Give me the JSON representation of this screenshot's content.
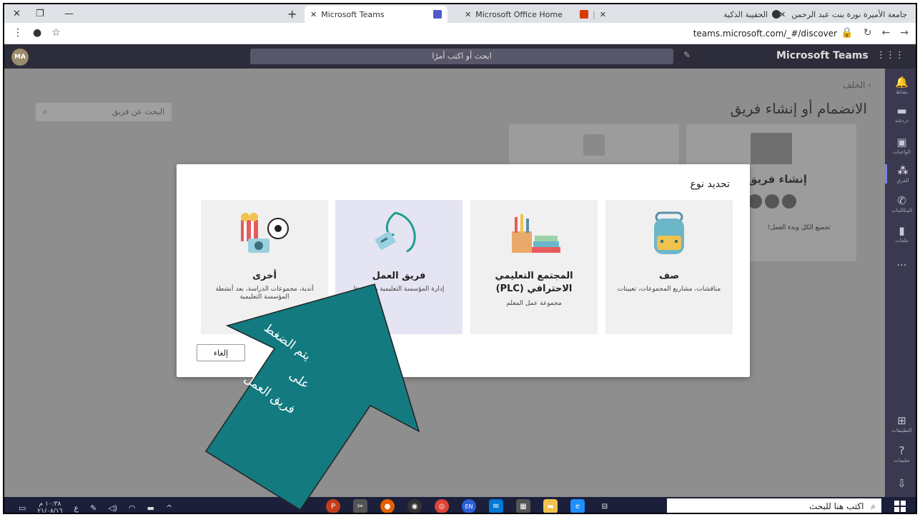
{
  "browser": {
    "tabs": [
      {
        "title": "Microsoft Teams",
        "active": true
      },
      {
        "title": "Microsoft Office Home",
        "active": false
      },
      {
        "title": "جامعة الأميرة نورة بنت عبد الرحمن",
        "active": false
      },
      {
        "title": "الحقيبة الذكية",
        "active": false
      }
    ],
    "new_tab_label": "+",
    "url": "teams.microsoft.com/_#/discover"
  },
  "teams": {
    "app_title": "Microsoft Teams",
    "avatar_initials": "MA",
    "search_placeholder": "ابحث أو اكتب أمرًا",
    "back_label": "الخلف",
    "page_title": "الانضمام أو إنشاء فريق",
    "team_search_placeholder": "البحث عن فريق",
    "bg_card_title": "إنشاء فريق",
    "bg_card_sub": "تجميع الكل وبدء العمل!",
    "rail": [
      {
        "icon": "bell-icon",
        "label": "نشاط"
      },
      {
        "icon": "chat-icon",
        "label": "دردشة"
      },
      {
        "icon": "assignments-icon",
        "label": "الواجبات"
      },
      {
        "icon": "teams-icon",
        "label": "الفرق"
      },
      {
        "icon": "calls-icon",
        "label": "المكالمات"
      },
      {
        "icon": "files-icon",
        "label": "ملفات"
      },
      {
        "icon": "more-icon",
        "label": "..."
      },
      {
        "icon": "apps-icon",
        "label": "التطبيقات"
      },
      {
        "icon": "help-icon",
        "label": "تعليمات"
      }
    ]
  },
  "modal": {
    "title": "تحديد نوع",
    "cards": [
      {
        "key": "class",
        "title": "صف",
        "desc": "مناقشات، مشاريع المجموعات، تعيينات"
      },
      {
        "key": "plc",
        "title": "المجتمع التعليمي الاحترافي (PLC)",
        "desc": "مجموعة عمل المعلم"
      },
      {
        "key": "staff",
        "title": "فريق العمل",
        "desc": "إدارة المؤسسة التعليمية وتطويرها"
      },
      {
        "key": "other",
        "title": "أخرى",
        "desc": "أندية، مجموعات الدراسة، بعد أنشطة المؤسسة التعليمية"
      }
    ],
    "cancel_label": "إلغاء"
  },
  "annotation": {
    "line1": "يتم الضغط",
    "line2": "على",
    "line3": "فريق العمل"
  },
  "taskbar": {
    "search_placeholder": "اكتب هنا للبحث",
    "time": "١٠:٣٨ م",
    "date": "٢١/٠٨/١٦",
    "lang": "ع",
    "lang_badge": "EN"
  },
  "colors": {
    "teams_header": "#2d2c3a",
    "rail": "#3a3950",
    "arrow": "#137a7f",
    "taskbar": "#1b1f3a"
  }
}
